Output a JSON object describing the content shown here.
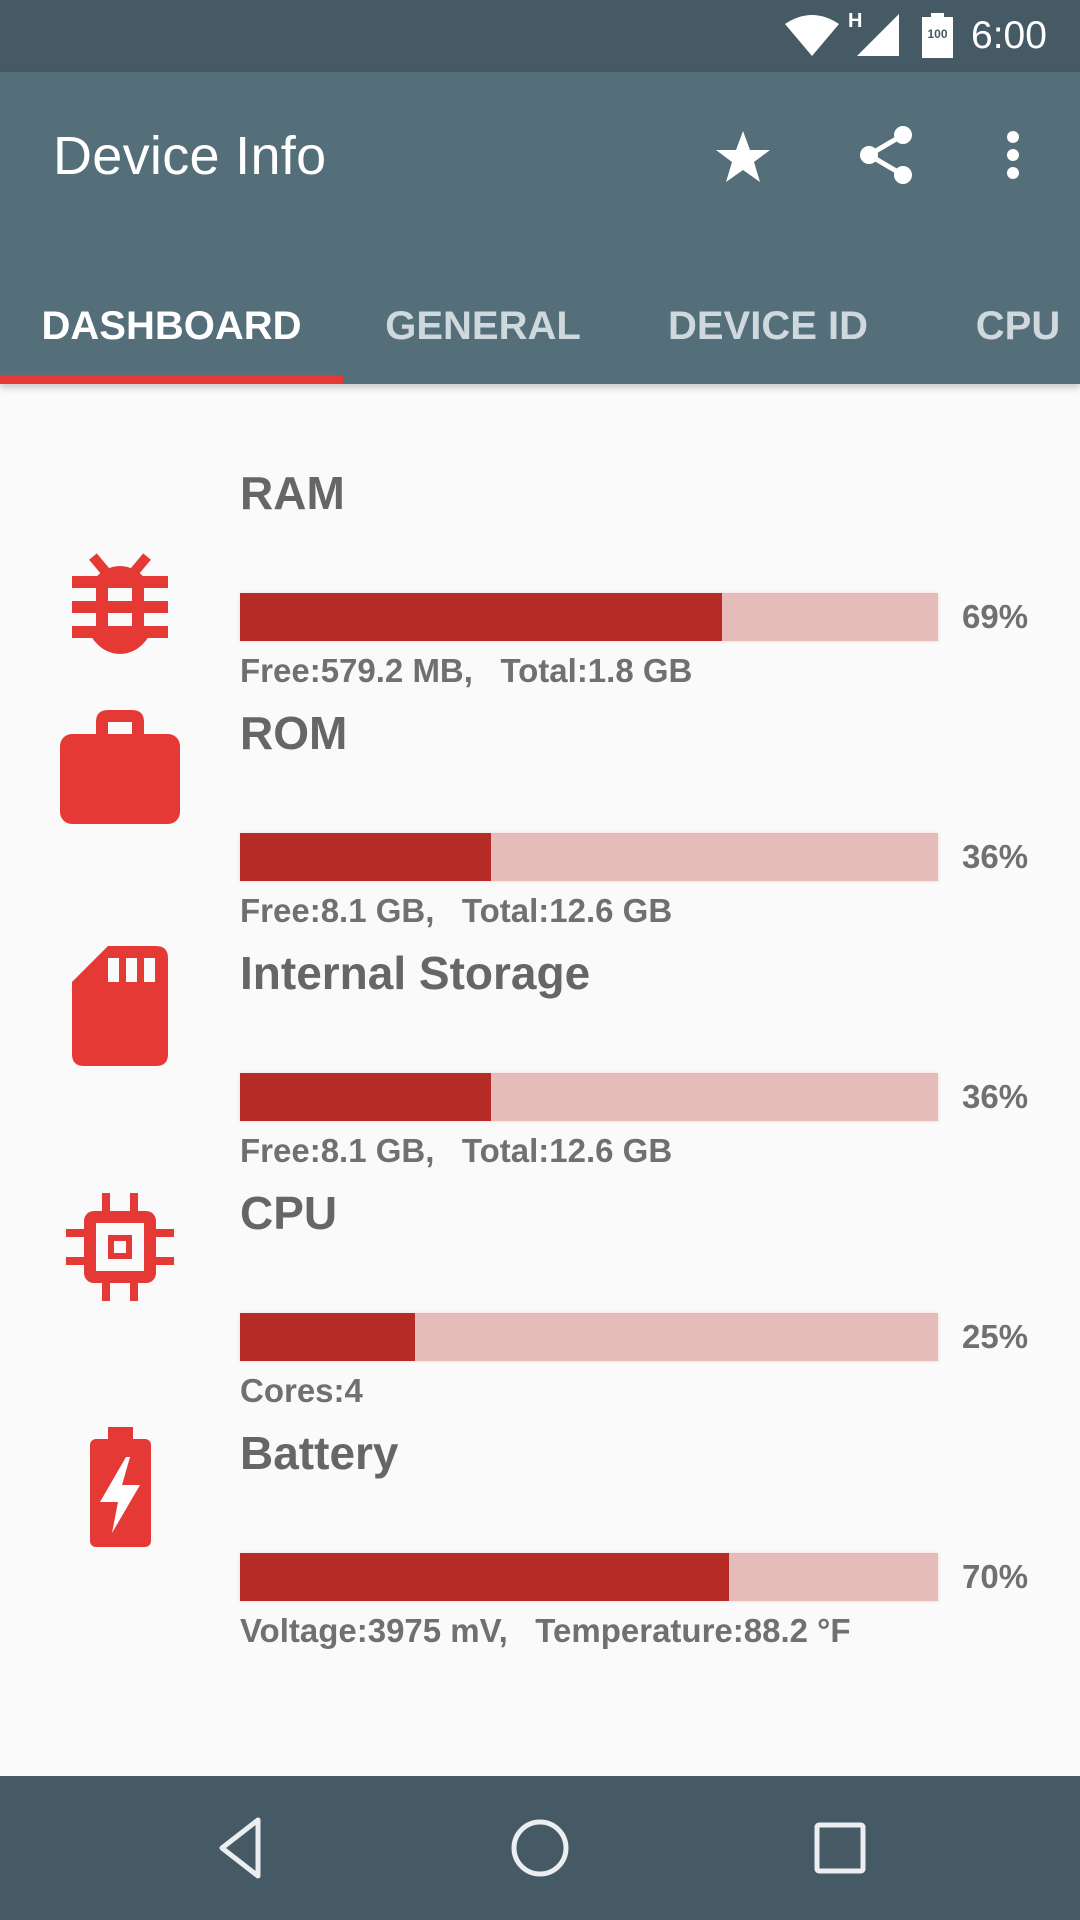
{
  "status_bar": {
    "network_type": "H",
    "battery_level": "100",
    "time": "6:00",
    "icons": [
      "wifi-icon",
      "cell-signal-icon",
      "battery-icon"
    ]
  },
  "app_bar": {
    "title": "Device Info",
    "actions": [
      {
        "name": "favorite",
        "icon": "star-icon"
      },
      {
        "name": "share",
        "icon": "share-icon"
      },
      {
        "name": "more",
        "icon": "more-vert-icon"
      }
    ]
  },
  "tabs": [
    {
      "label": "DASHBOARD",
      "active": true
    },
    {
      "label": "GENERAL",
      "active": false
    },
    {
      "label": "DEVICE ID",
      "active": false
    },
    {
      "label": "CPU",
      "active": false
    }
  ],
  "colors": {
    "status_bar": "#455a64",
    "app_bar": "#546e7a",
    "accent": "#e53935",
    "bar_fill": "#b72b27",
    "bar_track": "#e6bcbb",
    "text_secondary": "#707070"
  },
  "dashboard": {
    "items": [
      {
        "id": "ram",
        "icon": "bug-icon",
        "title": "RAM",
        "percent": 69,
        "percent_label": "69%",
        "detail": "Free:579.2 MB,   Total:1.8 GB"
      },
      {
        "id": "rom",
        "icon": "briefcase-icon",
        "title": "ROM",
        "percent": 36,
        "percent_label": "36%",
        "detail": "Free:8.1 GB,   Total:12.6 GB"
      },
      {
        "id": "internal-storage",
        "icon": "sd-card-icon",
        "title": "Internal Storage",
        "percent": 36,
        "percent_label": "36%",
        "detail": "Free:8.1 GB,   Total:12.6 GB"
      },
      {
        "id": "cpu",
        "icon": "cpu-chip-icon",
        "title": "CPU",
        "percent": 25,
        "percent_label": "25%",
        "detail": "Cores:4"
      },
      {
        "id": "battery",
        "icon": "battery-charging-icon",
        "title": "Battery",
        "percent": 70,
        "percent_label": "70%",
        "detail": "Voltage:3975 mV,   Temperature:88.2 °F"
      }
    ]
  },
  "nav_bar": {
    "buttons": [
      {
        "name": "back",
        "icon": "back-triangle-icon"
      },
      {
        "name": "home",
        "icon": "home-circle-icon"
      },
      {
        "name": "recents",
        "icon": "recents-square-icon"
      }
    ]
  }
}
